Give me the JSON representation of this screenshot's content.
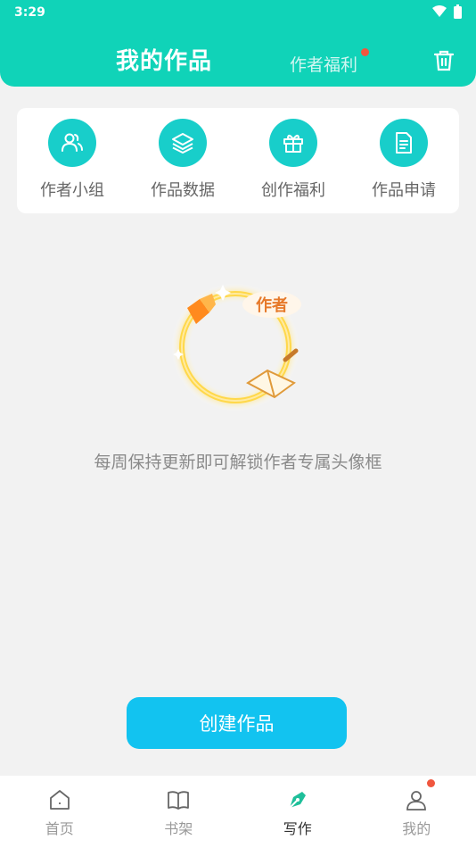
{
  "status_bar": {
    "time": "3:29"
  },
  "header": {
    "title": "我的作品",
    "welfare_link": "作者福利"
  },
  "quick_actions": [
    {
      "label": "作者小组",
      "icon": "people-icon"
    },
    {
      "label": "作品数据",
      "icon": "layers-icon"
    },
    {
      "label": "创作福利",
      "icon": "gift-icon"
    },
    {
      "label": "作品申请",
      "icon": "document-icon"
    }
  ],
  "empty_state": {
    "badge_text": "作者",
    "message": "每周保持更新即可解锁作者专属头像框"
  },
  "create_button": {
    "label": "创建作品"
  },
  "tabs": [
    {
      "label": "首页",
      "icon": "home-icon"
    },
    {
      "label": "书架",
      "icon": "book-icon"
    },
    {
      "label": "写作",
      "icon": "pen-icon"
    },
    {
      "label": "我的",
      "icon": "user-icon"
    }
  ],
  "colors": {
    "accent": "#10d3b8",
    "button": "#12c3f0",
    "badge": "#f0563e"
  }
}
